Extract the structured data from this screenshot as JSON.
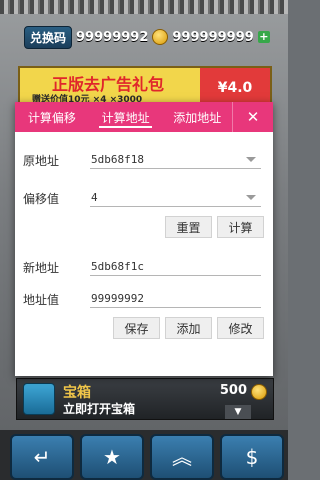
{
  "game": {
    "exchange_label": "兑换码",
    "diamond_count": "99999992",
    "coin_count": "999999999",
    "promo": {
      "title": "正版去广告礼包",
      "subtitle": "赠送价值10元 ×4 ×3000",
      "price": "¥4.0"
    },
    "chest": {
      "title": "宝箱",
      "subtitle": "立即打开宝箱",
      "cost": "500"
    }
  },
  "dialog": {
    "tabs": [
      {
        "label": "计算偏移"
      },
      {
        "label": "计算地址"
      },
      {
        "label": "添加地址"
      }
    ],
    "active_tab": 1,
    "close_symbol": "✕",
    "original_address": {
      "label": "原地址",
      "value": "5db68f18"
    },
    "offset": {
      "label": "偏移值",
      "value": "4"
    },
    "reset_label": "重置",
    "compute_label": "计算",
    "new_address": {
      "label": "新地址",
      "value": "5db68f1c"
    },
    "address_value": {
      "label": "地址值",
      "value": "99999992"
    },
    "save_label": "保存",
    "add_label": "添加",
    "modify_label": "修改"
  },
  "colors": {
    "accent": "#e8377b"
  }
}
